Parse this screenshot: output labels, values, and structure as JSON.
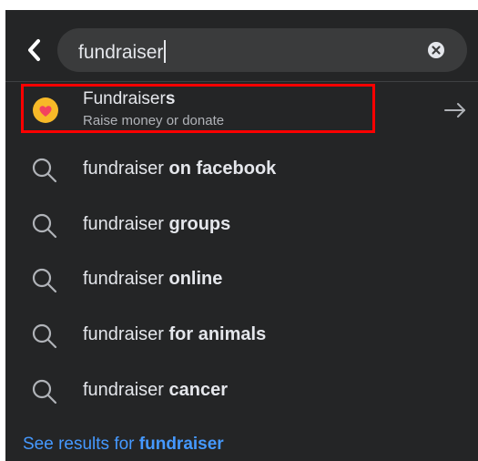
{
  "search": {
    "query": "fundraiser"
  },
  "top_result": {
    "title_base": "Fundraiser",
    "title_suffix": "s",
    "subtitle": "Raise money or donate"
  },
  "suggestions": [
    {
      "prefix": "fundraiser ",
      "completion": "on facebook"
    },
    {
      "prefix": "fundraiser ",
      "completion": "groups"
    },
    {
      "prefix": "fundraiser ",
      "completion": "online"
    },
    {
      "prefix": "fundraiser ",
      "completion": "for animals"
    },
    {
      "prefix": "fundraiser ",
      "completion": "cancer"
    }
  ],
  "see_results": {
    "prefix": "See results for ",
    "query": "fundraiser"
  },
  "colors": {
    "background": "#242526",
    "search_field": "#3a3b3c",
    "text_primary": "#e4e6eb",
    "text_secondary": "#b0b3b8",
    "link": "#4599ff",
    "highlight_border": "#ff0000",
    "icon_yellow": "#f7b928",
    "icon_heart": "#f3425f"
  }
}
